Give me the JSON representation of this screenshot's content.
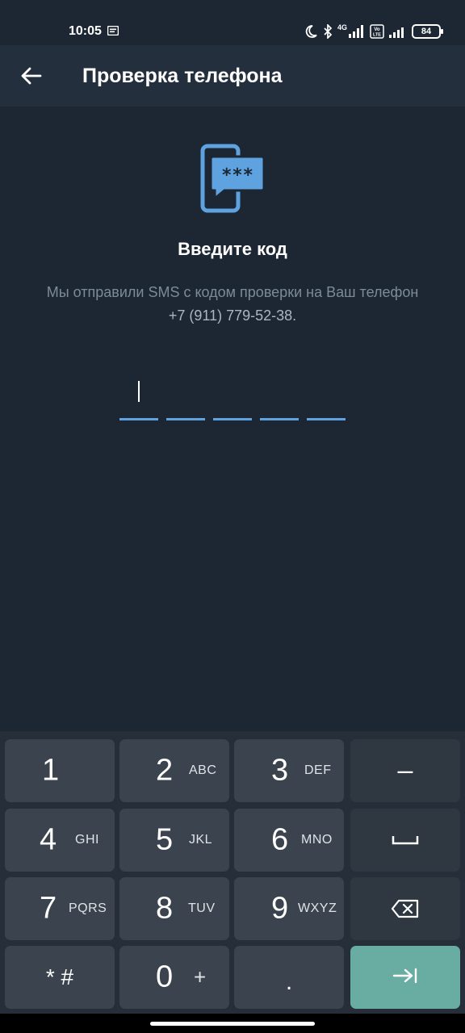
{
  "status_bar": {
    "time": "10:05",
    "network_1": "4G",
    "battery": "84",
    "icons": [
      "notification-icon",
      "moon-icon",
      "bluetooth-icon",
      "signal-icon",
      "volte-icon",
      "signal-icon-2",
      "battery-icon"
    ]
  },
  "header": {
    "title": "Проверка телефона",
    "back_icon": "arrow-left-icon"
  },
  "content": {
    "icon": "sms-code-phone-icon",
    "icon_text": "***",
    "heading": "Введите код",
    "description_line1": "Мы отправили SMS с кодом проверки на Ваш телефон",
    "phone": "+7 (911) 779-52-38."
  },
  "code_input": {
    "length": 5,
    "values": [
      "",
      "",
      "",
      "",
      ""
    ],
    "active_index": 0
  },
  "keyboard": {
    "rows": [
      [
        {
          "digit": "1",
          "letters": ""
        },
        {
          "digit": "2",
          "letters": "ABC"
        },
        {
          "digit": "3",
          "letters": "DEF"
        },
        {
          "symbol": "–"
        }
      ],
      [
        {
          "digit": "4",
          "letters": "GHI"
        },
        {
          "digit": "5",
          "letters": "JKL"
        },
        {
          "digit": "6",
          "letters": "MNO"
        },
        {
          "symbol": "space"
        }
      ],
      [
        {
          "digit": "7",
          "letters": "PQRS"
        },
        {
          "digit": "8",
          "letters": "TUV"
        },
        {
          "digit": "9",
          "letters": "WXYZ"
        },
        {
          "symbol": "backspace"
        }
      ],
      [
        {
          "symbol": "* #"
        },
        {
          "digit": "0",
          "letters": "+"
        },
        {
          "symbol": "."
        },
        {
          "symbol": "next"
        }
      ]
    ]
  },
  "colors": {
    "background": "#1d2733",
    "header": "#242f3d",
    "accent": "#5ea2e0",
    "key": "#3b444e",
    "key_action": "#69aca2"
  }
}
